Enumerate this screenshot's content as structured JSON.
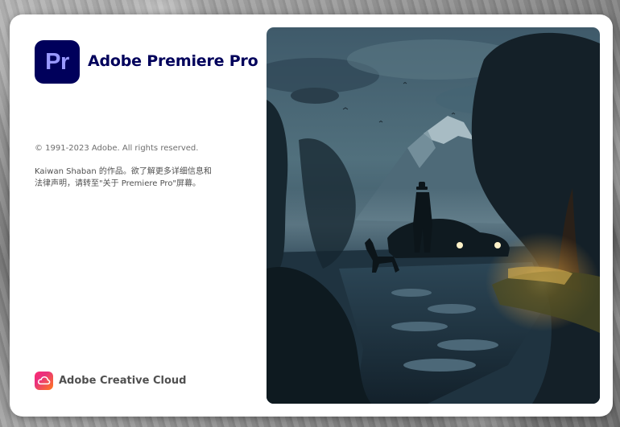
{
  "app": {
    "logo_text": "Pr",
    "title": "Adobe Premiere Pro",
    "brand_color": "#00005b",
    "logo_text_color": "#9999ff"
  },
  "legal": {
    "copyright": "© 1991-2023 Adobe. All rights reserved.",
    "credit_line1": "Kaiwan Shaban 的作品。欲了解更多详细信息和",
    "credit_line2": "法律声明，请转至\"关于 Premiere Pro\"屏幕。"
  },
  "footer": {
    "cc_label": "Adobe Creative Cloud",
    "cc_icon": "creative-cloud-icon"
  },
  "artwork": {
    "description_icon": "splash-artwork-image"
  }
}
